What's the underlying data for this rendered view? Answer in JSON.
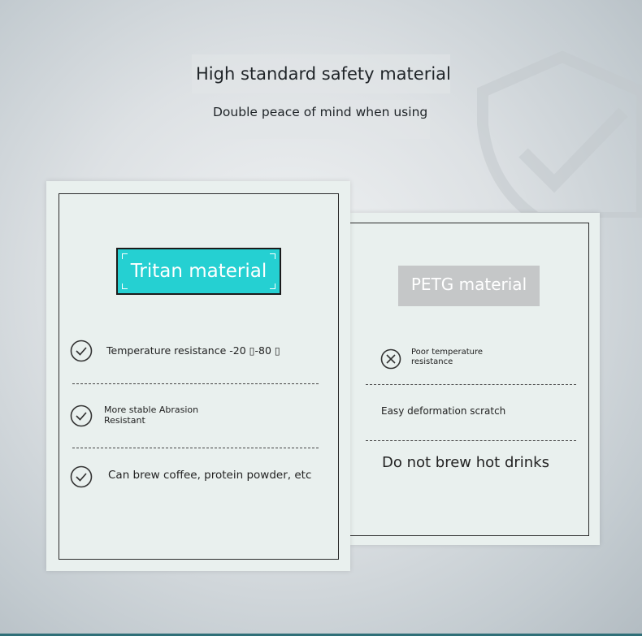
{
  "header": {
    "headline": "High standard safety material",
    "subheadline": "Double peace of mind when using"
  },
  "tritan_card": {
    "title": "Tritan material",
    "features": [
      {
        "icon": "check-circle-icon",
        "text": "Temperature resistance -20 ▯-80 ▯"
      },
      {
        "icon": "check-circle-icon",
        "text": "More stable Abrasion Resistant"
      },
      {
        "icon": "check-circle-icon",
        "text": "Can brew coffee, protein powder, etc"
      }
    ]
  },
  "petg_card": {
    "title": "PETG material",
    "features": [
      {
        "icon": "x-circle-icon",
        "text": "Poor temperature resistance"
      },
      {
        "text": "Easy deformation scratch"
      },
      {
        "text": "Do not brew hot drinks"
      }
    ]
  },
  "colors": {
    "tritan_accent": "#25d0d2",
    "petg_accent": "#c5c7c8",
    "card_background": "#e9f0ee",
    "frame_line": "#2b2b2b"
  }
}
